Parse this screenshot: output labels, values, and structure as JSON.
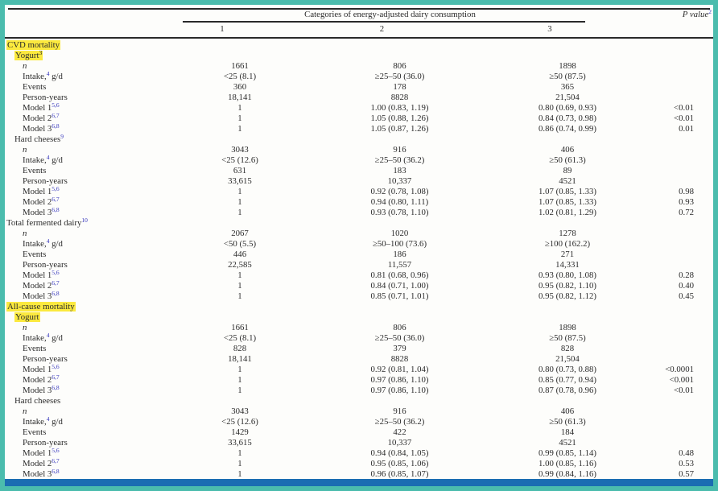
{
  "accent_colors": {
    "border_teal": "#4BBCAD",
    "highlight_yellow": "#FBE93E",
    "link_blue": "#3333BB",
    "bottom_bar_blue": "#1B6DB2"
  },
  "header": {
    "span_title": "Categories of energy-adjusted dairy consumption",
    "p_value_label": "P value",
    "p_value_sup": "2",
    "columns": [
      "1",
      "2",
      "3"
    ]
  },
  "table": {
    "rows": [
      {
        "pre": "CVD mortality",
        "sup": "",
        "post": "",
        "indent": 0,
        "hl": true,
        "it": false,
        "supDark": false,
        "c1": "",
        "c2": "",
        "c3": "",
        "p": ""
      },
      {
        "pre": "Yogurt",
        "sup": "3",
        "post": "",
        "indent": 1,
        "hl": true,
        "it": false,
        "supDark": true,
        "c1": "",
        "c2": "",
        "c3": "",
        "p": ""
      },
      {
        "pre": "n",
        "sup": "",
        "post": "",
        "indent": 2,
        "hl": false,
        "it": true,
        "supDark": false,
        "c1": "1661",
        "c2": "806",
        "c3": "1898",
        "p": ""
      },
      {
        "pre": "Intake,",
        "sup": "4",
        "post": " g/d",
        "indent": 2,
        "hl": false,
        "it": false,
        "supDark": false,
        "c1": "<25 (8.1)",
        "c2": "≥25–50 (36.0)",
        "c3": "≥50 (87.5)",
        "p": ""
      },
      {
        "pre": "Events",
        "sup": "",
        "post": "",
        "indent": 2,
        "hl": false,
        "it": false,
        "supDark": false,
        "c1": "360",
        "c2": "178",
        "c3": "365",
        "p": ""
      },
      {
        "pre": "Person-years",
        "sup": "",
        "post": "",
        "indent": 2,
        "hl": false,
        "it": false,
        "supDark": false,
        "c1": "18,141",
        "c2": "8828",
        "c3": "21,504",
        "p": ""
      },
      {
        "pre": "Model 1",
        "sup": "5,6",
        "post": "",
        "indent": 2,
        "hl": false,
        "it": false,
        "supDark": false,
        "c1": "1",
        "c2": "1.00 (0.83, 1.19)",
        "c3": "0.80 (0.69, 0.93)",
        "p": "<0.01"
      },
      {
        "pre": "Model 2",
        "sup": "6,7",
        "post": "",
        "indent": 2,
        "hl": false,
        "it": false,
        "supDark": false,
        "c1": "1",
        "c2": "1.05 (0.88, 1.26)",
        "c3": "0.84 (0.73, 0.98)",
        "p": "<0.01"
      },
      {
        "pre": "Model 3",
        "sup": "6,8",
        "post": "",
        "indent": 2,
        "hl": false,
        "it": false,
        "supDark": false,
        "c1": "1",
        "c2": "1.05 (0.87, 1.26)",
        "c3": "0.86 (0.74, 0.99)",
        "p": "0.01"
      },
      {
        "pre": "Hard cheeses",
        "sup": "9",
        "post": "",
        "indent": 1,
        "hl": false,
        "it": false,
        "supDark": false,
        "c1": "",
        "c2": "",
        "c3": "",
        "p": ""
      },
      {
        "pre": "n",
        "sup": "",
        "post": "",
        "indent": 2,
        "hl": false,
        "it": true,
        "supDark": false,
        "c1": "3043",
        "c2": "916",
        "c3": "406",
        "p": ""
      },
      {
        "pre": "Intake,",
        "sup": "4",
        "post": " g/d",
        "indent": 2,
        "hl": false,
        "it": false,
        "supDark": false,
        "c1": "<25 (12.6)",
        "c2": "≥25–50 (36.2)",
        "c3": "≥50 (61.3)",
        "p": ""
      },
      {
        "pre": "Events",
        "sup": "",
        "post": "",
        "indent": 2,
        "hl": false,
        "it": false,
        "supDark": false,
        "c1": "631",
        "c2": "183",
        "c3": "89",
        "p": ""
      },
      {
        "pre": "Person-years",
        "sup": "",
        "post": "",
        "indent": 2,
        "hl": false,
        "it": false,
        "supDark": false,
        "c1": "33,615",
        "c2": "10,337",
        "c3": "4521",
        "p": ""
      },
      {
        "pre": "Model 1",
        "sup": "5,6",
        "post": "",
        "indent": 2,
        "hl": false,
        "it": false,
        "supDark": false,
        "c1": "1",
        "c2": "0.92 (0.78, 1.08)",
        "c3": "1.07 (0.85, 1.33)",
        "p": "0.98"
      },
      {
        "pre": "Model 2",
        "sup": "6,7",
        "post": "",
        "indent": 2,
        "hl": false,
        "it": false,
        "supDark": false,
        "c1": "1",
        "c2": "0.94 (0.80, 1.11)",
        "c3": "1.07 (0.85, 1.33)",
        "p": "0.93"
      },
      {
        "pre": "Model 3",
        "sup": "6,8",
        "post": "",
        "indent": 2,
        "hl": false,
        "it": false,
        "supDark": false,
        "c1": "1",
        "c2": "0.93 (0.78, 1.10)",
        "c3": "1.02 (0.81, 1.29)",
        "p": "0.72"
      },
      {
        "pre": "Total fermented dairy",
        "sup": "10",
        "post": "",
        "indent": 0,
        "hl": false,
        "it": false,
        "supDark": false,
        "c1": "",
        "c2": "",
        "c3": "",
        "p": ""
      },
      {
        "pre": "n",
        "sup": "",
        "post": "",
        "indent": 2,
        "hl": false,
        "it": true,
        "supDark": false,
        "c1": "2067",
        "c2": "1020",
        "c3": "1278",
        "p": ""
      },
      {
        "pre": "Intake,",
        "sup": "4",
        "post": " g/d",
        "indent": 2,
        "hl": false,
        "it": false,
        "supDark": false,
        "c1": "<50 (5.5)",
        "c2": "≥50–100 (73.6)",
        "c3": "≥100 (162.2)",
        "p": ""
      },
      {
        "pre": "Events",
        "sup": "",
        "post": "",
        "indent": 2,
        "hl": false,
        "it": false,
        "supDark": false,
        "c1": "446",
        "c2": "186",
        "c3": "271",
        "p": ""
      },
      {
        "pre": "Person-years",
        "sup": "",
        "post": "",
        "indent": 2,
        "hl": false,
        "it": false,
        "supDark": false,
        "c1": "22,585",
        "c2": "11,557",
        "c3": "14,331",
        "p": ""
      },
      {
        "pre": "Model 1",
        "sup": "5,6",
        "post": "",
        "indent": 2,
        "hl": false,
        "it": false,
        "supDark": false,
        "c1": "1",
        "c2": "0.81 (0.68, 0.96)",
        "c3": "0.93 (0.80, 1.08)",
        "p": "0.28"
      },
      {
        "pre": "Model 2",
        "sup": "6,7",
        "post": "",
        "indent": 2,
        "hl": false,
        "it": false,
        "supDark": false,
        "c1": "1",
        "c2": "0.84 (0.71, 1.00)",
        "c3": "0.95 (0.82, 1.10)",
        "p": "0.40"
      },
      {
        "pre": "Model 3",
        "sup": "6,8",
        "post": "",
        "indent": 2,
        "hl": false,
        "it": false,
        "supDark": false,
        "c1": "1",
        "c2": "0.85 (0.71, 1.01)",
        "c3": "0.95 (0.82, 1.12)",
        "p": "0.45"
      },
      {
        "pre": "All-cause mortality",
        "sup": "",
        "post": "",
        "indent": 0,
        "hl": true,
        "it": false,
        "supDark": false,
        "c1": "",
        "c2": "",
        "c3": "",
        "p": ""
      },
      {
        "pre": "Yogurt",
        "sup": "",
        "post": "",
        "indent": 1,
        "hl": true,
        "it": false,
        "supDark": false,
        "c1": "",
        "c2": "",
        "c3": "",
        "p": ""
      },
      {
        "pre": "n",
        "sup": "",
        "post": "",
        "indent": 2,
        "hl": false,
        "it": true,
        "supDark": false,
        "c1": "1661",
        "c2": "806",
        "c3": "1898",
        "p": ""
      },
      {
        "pre": "Intake,",
        "sup": "4",
        "post": " g/d",
        "indent": 2,
        "hl": false,
        "it": false,
        "supDark": false,
        "c1": "<25 (8.1)",
        "c2": "≥25–50 (36.0)",
        "c3": "≥50 (87.5)",
        "p": ""
      },
      {
        "pre": "Events",
        "sup": "",
        "post": "",
        "indent": 2,
        "hl": false,
        "it": false,
        "supDark": false,
        "c1": "828",
        "c2": "379",
        "c3": "828",
        "p": ""
      },
      {
        "pre": "Person-years",
        "sup": "",
        "post": "",
        "indent": 2,
        "hl": false,
        "it": false,
        "supDark": false,
        "c1": "18,141",
        "c2": "8828",
        "c3": "21,504",
        "p": ""
      },
      {
        "pre": "Model 1",
        "sup": "5,6",
        "post": "",
        "indent": 2,
        "hl": false,
        "it": false,
        "supDark": false,
        "c1": "1",
        "c2": "0.92 (0.81, 1.04)",
        "c3": "0.80 (0.73, 0.88)",
        "p": "<0.0001"
      },
      {
        "pre": "Model 2",
        "sup": "6,7",
        "post": "",
        "indent": 2,
        "hl": false,
        "it": false,
        "supDark": false,
        "c1": "1",
        "c2": "0.97 (0.86, 1.10)",
        "c3": "0.85 (0.77, 0.94)",
        "p": "<0.001"
      },
      {
        "pre": "Model 3",
        "sup": "6,8",
        "post": "",
        "indent": 2,
        "hl": false,
        "it": false,
        "supDark": false,
        "c1": "1",
        "c2": "0.97 (0.86, 1.10)",
        "c3": "0.87 (0.78, 0.96)",
        "p": "<0.01"
      },
      {
        "pre": "Hard cheeses",
        "sup": "",
        "post": "",
        "indent": 1,
        "hl": false,
        "it": false,
        "supDark": false,
        "c1": "",
        "c2": "",
        "c3": "",
        "p": ""
      },
      {
        "pre": "n",
        "sup": "",
        "post": "",
        "indent": 2,
        "hl": false,
        "it": true,
        "supDark": false,
        "c1": "3043",
        "c2": "916",
        "c3": "406",
        "p": ""
      },
      {
        "pre": "Intake,",
        "sup": "4",
        "post": " g/d",
        "indent": 2,
        "hl": false,
        "it": false,
        "supDark": false,
        "c1": "<25 (12.6)",
        "c2": "≥25–50 (36.2)",
        "c3": "≥50 (61.3)",
        "p": ""
      },
      {
        "pre": "Events",
        "sup": "",
        "post": "",
        "indent": 2,
        "hl": false,
        "it": false,
        "supDark": false,
        "c1": "1429",
        "c2": "422",
        "c3": "184",
        "p": ""
      },
      {
        "pre": "Person-years",
        "sup": "",
        "post": "",
        "indent": 2,
        "hl": false,
        "it": false,
        "supDark": false,
        "c1": "33,615",
        "c2": "10,337",
        "c3": "4521",
        "p": ""
      },
      {
        "pre": "Model 1",
        "sup": "5,6",
        "post": "",
        "indent": 2,
        "hl": false,
        "it": false,
        "supDark": false,
        "c1": "1",
        "c2": "0.94 (0.84, 1.05)",
        "c3": "0.99 (0.85, 1.14)",
        "p": "0.48"
      },
      {
        "pre": "Model 2",
        "sup": "6,7",
        "post": "",
        "indent": 2,
        "hl": false,
        "it": false,
        "supDark": false,
        "c1": "1",
        "c2": "0.95 (0.85, 1.06)",
        "c3": "1.00 (0.85, 1.16)",
        "p": "0.53"
      },
      {
        "pre": "Model 3",
        "sup": "6,8",
        "post": "",
        "indent": 2,
        "hl": false,
        "it": false,
        "supDark": false,
        "c1": "1",
        "c2": "0.96 (0.85, 1.07)",
        "c3": "0.99 (0.84, 1.16)",
        "p": "0.57"
      }
    ]
  }
}
